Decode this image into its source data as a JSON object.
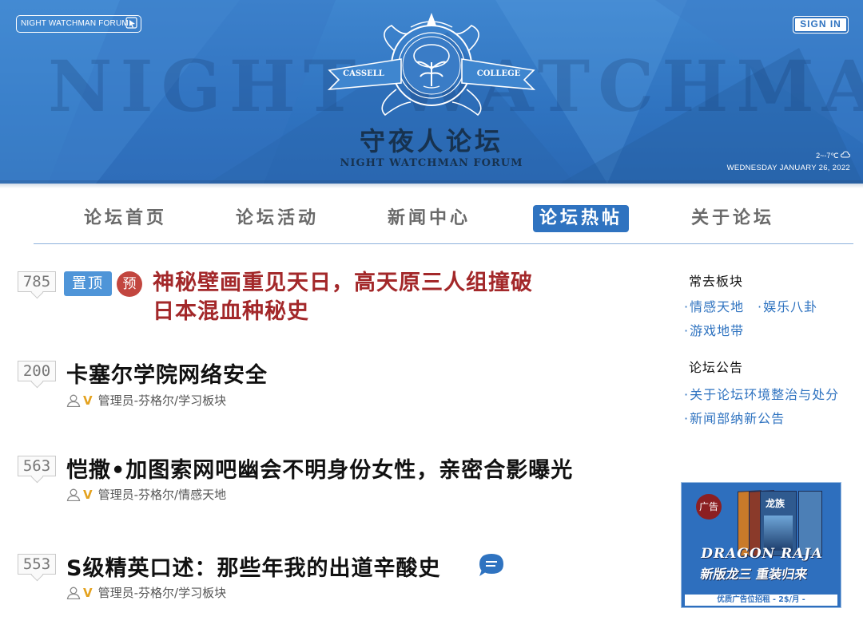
{
  "header": {
    "forum_badge": "NIGHT WATCHMAN FORUM",
    "sign_in_label": "SIGN IN",
    "watermark": "NIGHT WATCHMAN",
    "emblem_left_text": "CASSELL",
    "emblem_right_text": "COLLEGE",
    "title_cn": "守夜人论坛",
    "title_en": "NIGHT WATCHMAN FORUM",
    "weather": "2~-7℃",
    "date": "WEDNESDAY JANUARY 26, 2022",
    "colors": {
      "banner": "#2f73c0",
      "title": "#17324f"
    }
  },
  "nav": {
    "items": [
      {
        "label": "论坛首页"
      },
      {
        "label": "论坛活动"
      },
      {
        "label": "新闻中心"
      },
      {
        "label": "论坛热帖"
      },
      {
        "label": "关于论坛"
      }
    ],
    "active_index": 3
  },
  "posts": [
    {
      "count": "785",
      "pin_label": "置顶",
      "pre_label": "预",
      "title_line1": "神秘壁画重见天日，高天原三人组撞破",
      "title_line2": "日本混血种秘史"
    },
    {
      "count": "200",
      "title": "卡塞尔学院网络安全",
      "badge": "V",
      "meta": "管理员-芬格尔/学习板块"
    },
    {
      "count": "563",
      "title": "恺撒•加图索网吧幽会不明身份女性，亲密合影曝光",
      "badge": "V",
      "meta": "管理员-芬格尔/情感天地"
    },
    {
      "count": "553",
      "title": "S级精英口述：那些年我的出道辛酸史",
      "badge": "V",
      "meta": "管理员-芬格尔/学习板块"
    }
  ],
  "sidebar": {
    "frequent_title": "常去板块",
    "frequent_links": [
      "情感天地",
      "娱乐八卦",
      "游戏地带"
    ],
    "notice_title": "论坛公告",
    "notice_links": [
      "关于论坛环境整治与处分",
      "新闻部纳新公告"
    ]
  },
  "ad": {
    "tag": "广告",
    "book_title": "龙族",
    "headline": "DRAGON RAJA",
    "slogan": "新版龙三 重装归来",
    "footer": "优质广告位招租  - 2$/月 -"
  }
}
